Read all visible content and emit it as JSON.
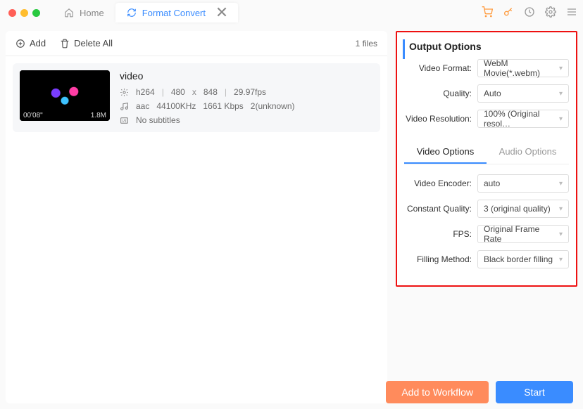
{
  "tabs": {
    "home_label": "Home",
    "convert_label": "Format Convert"
  },
  "toolbar": {
    "add_label": "Add",
    "delete_all_label": "Delete All",
    "file_count": "1 files"
  },
  "file": {
    "title": "video",
    "duration": "00'08\"",
    "size": "1.8M",
    "vcodec": "h264",
    "width": "480",
    "height": "848",
    "dim_sep": "x",
    "fps": "29.97fps",
    "acodec": "aac",
    "sample_rate": "44100KHz",
    "abitrate": "1661 Kbps",
    "achannels": "2(unknown)",
    "subtitles": "No subtitles"
  },
  "output": {
    "panel_title": "Output Options",
    "labels": {
      "video_format": "Video Format:",
      "quality": "Quality:",
      "video_resolution": "Video Resolution:"
    },
    "values": {
      "video_format": "WebM Movie(*.webm)",
      "quality": "Auto",
      "video_resolution": "100% (Original resol…"
    }
  },
  "subtabs": {
    "video": "Video Options",
    "audio": "Audio Options"
  },
  "video_opts": {
    "labels": {
      "encoder": "Video Encoder:",
      "cq": "Constant Quality:",
      "fps": "FPS:",
      "fill": "Filling Method:"
    },
    "values": {
      "encoder": "auto",
      "cq": "3 (original quality)",
      "fps": "Original Frame Rate",
      "fill": "Black border filling"
    }
  },
  "footer": {
    "workflow": "Add to Workflow",
    "start": "Start"
  }
}
